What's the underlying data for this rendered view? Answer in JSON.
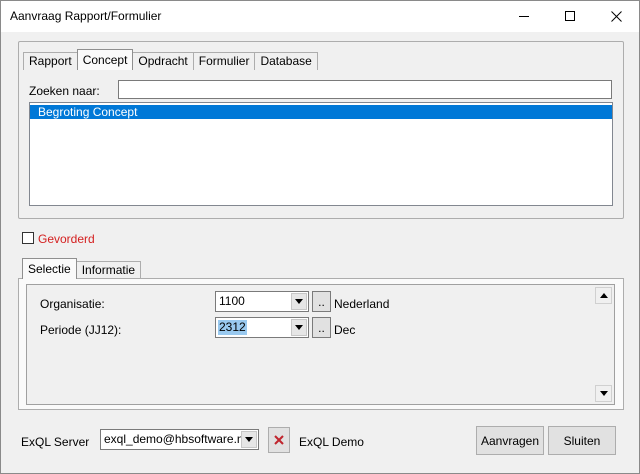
{
  "window": {
    "title": "Aanvraag Rapport/Formulier"
  },
  "main_tabs": [
    {
      "label": "Rapport"
    },
    {
      "label": "Concept"
    },
    {
      "label": "Opdracht"
    },
    {
      "label": "Formulier"
    },
    {
      "label": "Database"
    }
  ],
  "search": {
    "label": "Zoeken naar:",
    "value": ""
  },
  "list": {
    "items": [
      {
        "label": "Begroting Concept",
        "selected": true
      }
    ]
  },
  "advanced": {
    "label": "Gevorderd",
    "checked": false,
    "color": "#d41f1f"
  },
  "sub_tabs": [
    {
      "label": "Selectie"
    },
    {
      "label": "Informatie"
    }
  ],
  "selection": {
    "rows": [
      {
        "label": "Organisatie:",
        "value": "1100",
        "browse_label": "..",
        "description": "Nederland"
      },
      {
        "label": "Periode (JJ12):",
        "value": "2312",
        "browse_label": "..",
        "description": "Dec"
      }
    ]
  },
  "footer": {
    "server_label": "ExQL Server",
    "server_value": "exql_demo@hbsoftware.nl",
    "server_name": "ExQL Demo",
    "request_label": "Aanvragen",
    "close_label": "Sluiten"
  },
  "icons": {
    "minimize": "minimize-icon",
    "maximize": "maximize-icon",
    "close": "close-icon",
    "disconnect": "red-x-icon",
    "dropdown": "chevron-down-icon"
  },
  "colors": {
    "selection": "#0078d7",
    "accent_red": "#d41f1f"
  }
}
